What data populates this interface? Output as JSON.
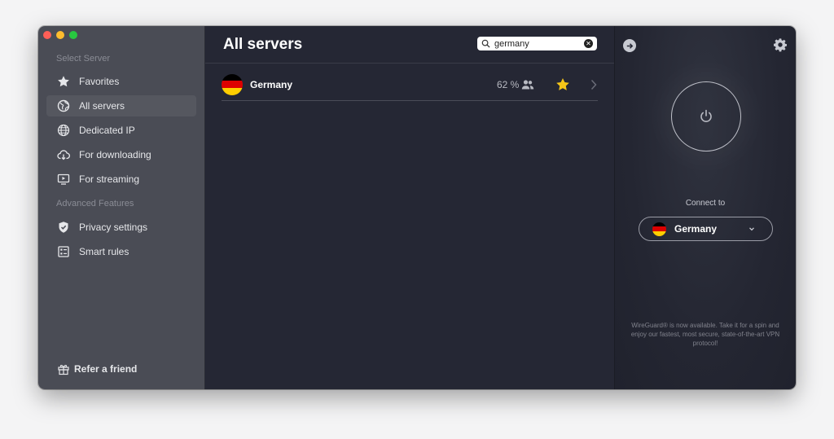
{
  "sidebar": {
    "section_select": "Select Server",
    "section_advanced": "Advanced Features",
    "items": [
      {
        "label": "Favorites",
        "icon": "star-icon"
      },
      {
        "label": "All servers",
        "icon": "globe-icon"
      },
      {
        "label": "Dedicated IP",
        "icon": "globe-grid-icon"
      },
      {
        "label": "For downloading",
        "icon": "cloud-download-icon"
      },
      {
        "label": "For streaming",
        "icon": "play-screen-icon"
      },
      {
        "label": "Privacy settings",
        "icon": "shield-check-icon"
      },
      {
        "label": "Smart rules",
        "icon": "rules-icon"
      }
    ],
    "refer_label": "Refer a friend"
  },
  "main": {
    "title": "All servers",
    "search": {
      "value": "germany",
      "placeholder": ""
    },
    "servers": [
      {
        "name": "Germany",
        "load": "62 %",
        "favorite": true
      }
    ]
  },
  "right": {
    "connect_label": "Connect to",
    "selected_country": "Germany",
    "notice": "WireGuard® is now available. Take it for a spin and enjoy our fastest, most secure, state-of-the-art VPN protocol!"
  },
  "colors": {
    "sidebar_bg": "#4a4c55",
    "main_bg": "#252734",
    "star": "#f5c518",
    "flag_black": "#000000",
    "flag_red": "#dd0000",
    "flag_gold": "#ffce00"
  }
}
